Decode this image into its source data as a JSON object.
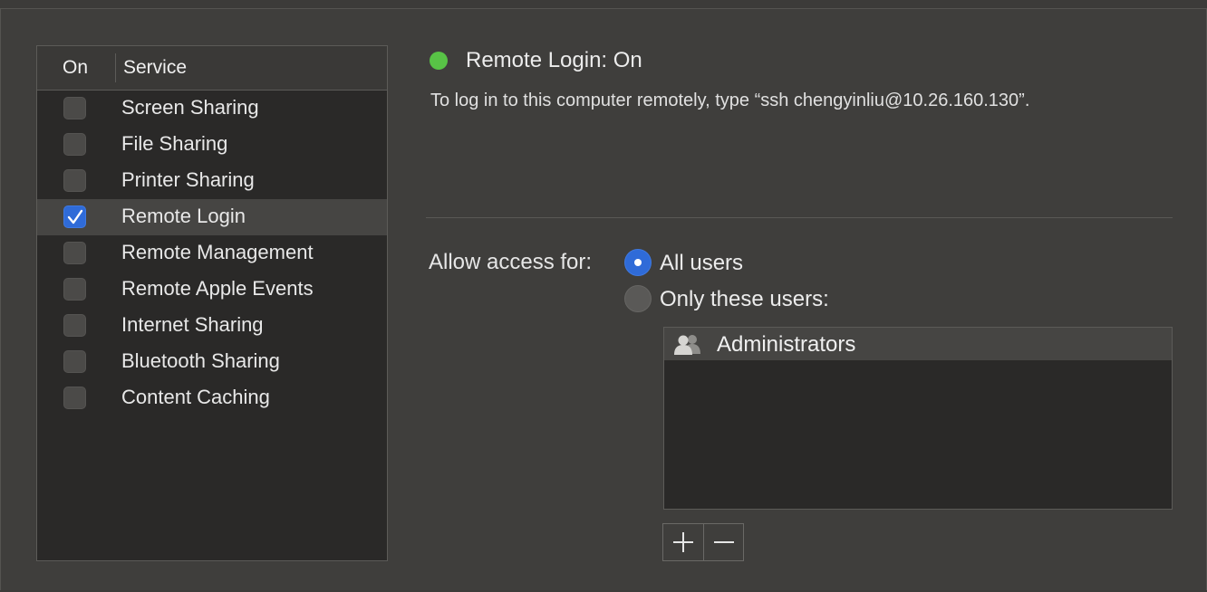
{
  "services_table": {
    "col_on": "On",
    "col_service": "Service",
    "rows": [
      {
        "label": "Screen Sharing",
        "checked": false
      },
      {
        "label": "File Sharing",
        "checked": false
      },
      {
        "label": "Printer Sharing",
        "checked": false
      },
      {
        "label": "Remote Login",
        "checked": true,
        "selected": true
      },
      {
        "label": "Remote Management",
        "checked": false
      },
      {
        "label": "Remote Apple Events",
        "checked": false
      },
      {
        "label": "Internet Sharing",
        "checked": false
      },
      {
        "label": "Bluetooth Sharing",
        "checked": false
      },
      {
        "label": "Content Caching",
        "checked": false
      }
    ]
  },
  "status": {
    "title": "Remote Login: On",
    "description": "To log in to this computer remotely, type “ssh chengyinliu@10.26.160.130”.",
    "color": "#58c346"
  },
  "access": {
    "label": "Allow access for:",
    "all_users": "All users",
    "only_these_users": "Only these users:",
    "selected": "All users"
  },
  "users_list": {
    "items": [
      {
        "name": "Administrators",
        "icon": "group-icon"
      }
    ]
  },
  "buttons": {
    "add_icon": "plus-icon",
    "remove_icon": "minus-icon"
  },
  "colors": {
    "accent": "#2f6bd8",
    "status_on": "#58c346"
  }
}
